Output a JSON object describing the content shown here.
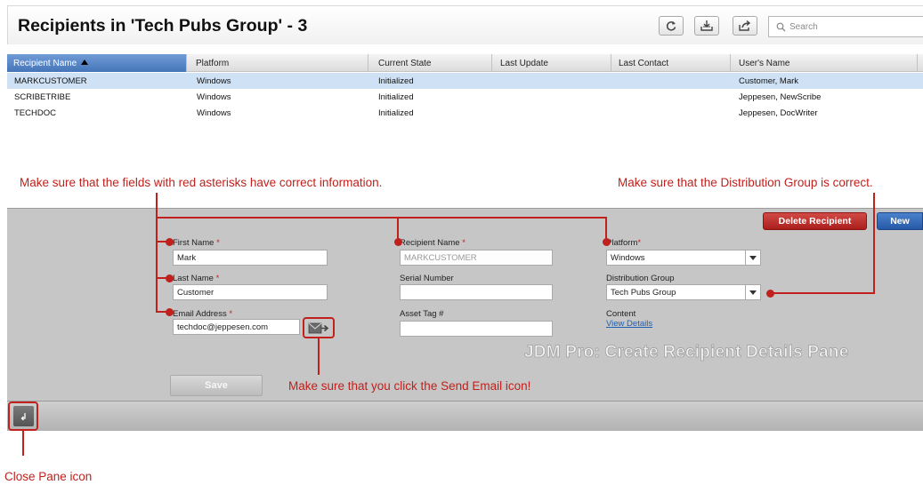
{
  "header": {
    "title": "Recipients in 'Tech Pubs Group' - 3",
    "search_placeholder": "Search"
  },
  "toolbar": {
    "icons": [
      "refresh-icon",
      "import-icon",
      "export-icon",
      "search-icon"
    ]
  },
  "table": {
    "columns": [
      "Recipient Name",
      "Platform",
      "Current State",
      "Last Update",
      "Last Contact",
      "User's Name"
    ],
    "sorted_column": "Recipient Name",
    "sort_direction": "ascending",
    "rows": [
      [
        "MARKCUSTOMER",
        "Windows",
        "Initialized",
        "",
        "",
        "Customer, Mark"
      ],
      [
        "SCRIBETRIBE",
        "Windows",
        "Initialized",
        "",
        "",
        "Jeppesen, NewScribe"
      ],
      [
        "TECHDOC",
        "Windows",
        "Initialized",
        "",
        "",
        "Jeppesen, DocWriter"
      ]
    ],
    "selected_row": 0
  },
  "form": {
    "first_name": {
      "label": "First Name",
      "value": "Mark",
      "required": true
    },
    "last_name": {
      "label": "Last Name",
      "value": "Customer",
      "required": true
    },
    "email": {
      "label": "Email Address",
      "value": "techdoc@jeppesen.com",
      "required": true
    },
    "recipient_name": {
      "label": "Recipient Name",
      "value": "MARKCUSTOMER",
      "required": true
    },
    "serial_number": {
      "label": "Serial Number",
      "value": ""
    },
    "asset_tag": {
      "label": "Asset Tag #",
      "value": ""
    },
    "platform": {
      "label": "Platform",
      "value": "Windows",
      "required": true
    },
    "distribution_group": {
      "label": "Distribution Group",
      "value": "Tech Pubs Group"
    },
    "content": {
      "label": "Content",
      "link": "View Details"
    },
    "required_marker": "*"
  },
  "buttons": {
    "delete": "Delete Recipient",
    "new": "New",
    "save": "Save"
  },
  "watermark": "JDM Pro:  Create Recipient Details Pane",
  "annotations": {
    "asterisks": "Make sure that the fields with red asterisks have correct information.",
    "distribution": "Make sure that the Distribution Group is correct.",
    "send_email": "Make sure that you click the Send Email icon!",
    "close_pane": "Close Pane icon"
  },
  "colors": {
    "annotation_red": "#c0211c",
    "selected_row": "#cfe2f5",
    "selected_header": "#4675b9",
    "delete_button": "#ab1f1b",
    "new_button": "#2659a6"
  }
}
